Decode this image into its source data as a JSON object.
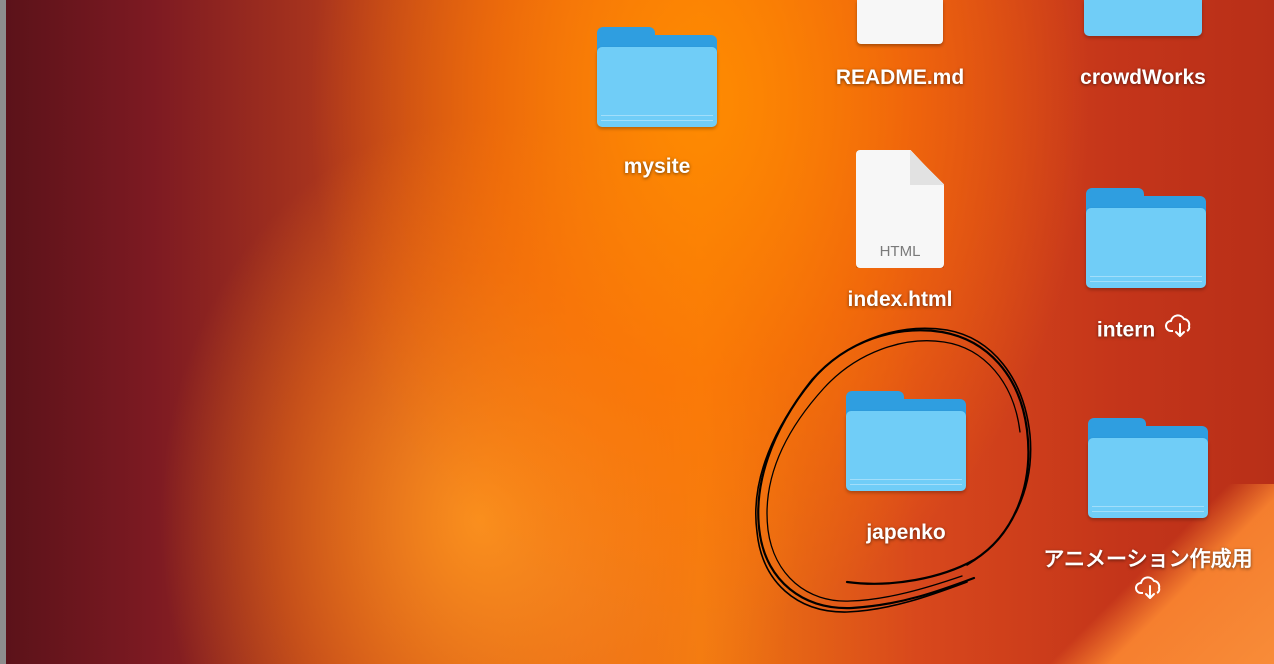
{
  "desktop": {
    "items": [
      {
        "label": "README.md",
        "kind": "document"
      },
      {
        "label": "crowdWorks",
        "kind": "folder"
      },
      {
        "label": "mysite",
        "kind": "folder"
      },
      {
        "label": "index.html",
        "kind": "document",
        "file_tag": "HTML"
      },
      {
        "label": "intern",
        "kind": "folder",
        "icloud": true
      },
      {
        "label": "japenko",
        "kind": "folder",
        "annotated": true
      },
      {
        "label": "アニメーション作成用",
        "kind": "folder",
        "icloud": true
      }
    ]
  },
  "colors": {
    "folder_front": "#70cdf7",
    "folder_back": "#2f9ee0",
    "annotation_stroke": "#000000"
  },
  "icons": {
    "cloud": "icloud-download-icon"
  }
}
